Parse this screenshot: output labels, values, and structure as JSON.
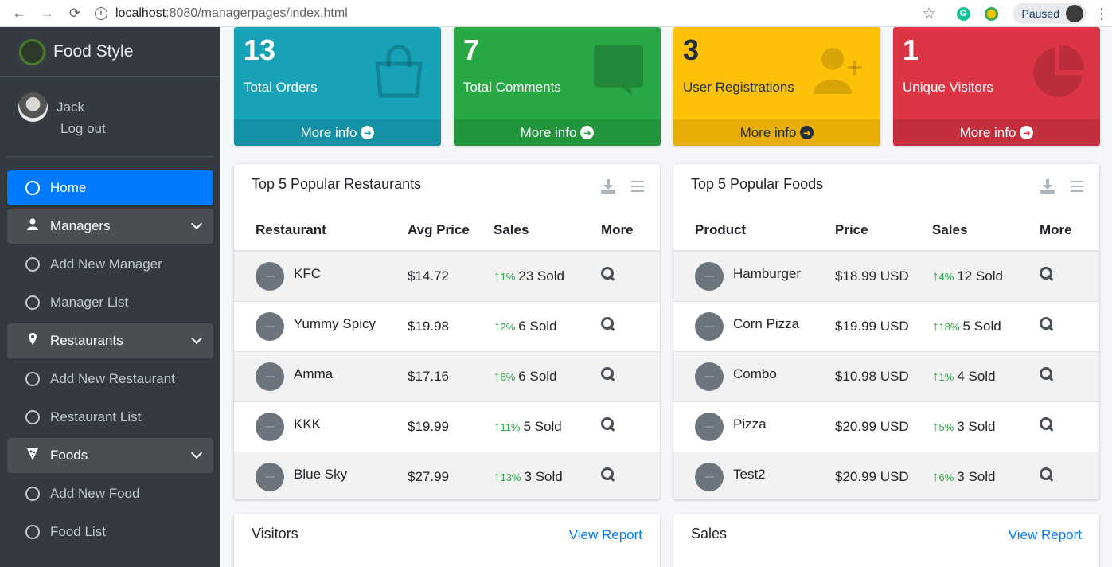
{
  "browser": {
    "back": "←",
    "forward": "→",
    "reload": "⟳",
    "info": "i",
    "url_host": "localhost",
    "url_path": ":8080/managerpages/index.html",
    "bookmark": "☆",
    "grammarly": "G",
    "paused": "Paused",
    "menu": "⋮"
  },
  "brand": {
    "name": "Food Style"
  },
  "user": {
    "name": "Jack",
    "logout": "Log out"
  },
  "menu": {
    "home": "Home",
    "managers": "Managers",
    "add_manager": "Add New Manager",
    "manager_list": "Manager List",
    "restaurants": "Restaurants",
    "add_restaurant": "Add New Restaurant",
    "restaurant_list": "Restaurant List",
    "foods": "Foods",
    "add_food": "Add New Food",
    "food_list": "Food List"
  },
  "stats": [
    {
      "value": "13",
      "label": "Total Orders",
      "more": "More info",
      "color": "#17a2b8"
    },
    {
      "value": "7",
      "label": "Total Comments",
      "more": "More info",
      "color": "#28a745"
    },
    {
      "value": "3",
      "label": "User Registrations",
      "more": "More info",
      "color": "#ffc107"
    },
    {
      "value": "1",
      "label": "Unique Visitors",
      "more": "More info",
      "color": "#dc3545"
    }
  ],
  "restaurants": {
    "title": "Top 5 Popular Restaurants",
    "headers": [
      "Restaurant",
      "Avg Price",
      "Sales",
      "More"
    ],
    "rows": [
      {
        "name": "KFC",
        "price": "$14.72",
        "pct": "1%",
        "sold": "23 Sold"
      },
      {
        "name": "Yummy Spicy",
        "price": "$19.98",
        "pct": "2%",
        "sold": "6 Sold"
      },
      {
        "name": "Amma",
        "price": "$17.16",
        "pct": "6%",
        "sold": "6 Sold"
      },
      {
        "name": "KKK",
        "price": "$19.99",
        "pct": "11%",
        "sold": "5 Sold"
      },
      {
        "name": "Blue Sky",
        "price": "$27.99",
        "pct": "13%",
        "sold": "3 Sold"
      }
    ]
  },
  "foods": {
    "title": "Top 5 Popular Foods",
    "headers": [
      "Product",
      "Price",
      "Sales",
      "More"
    ],
    "rows": [
      {
        "name": "Hamburger",
        "price": "$18.99 USD",
        "pct": "4%",
        "sold": "12 Sold"
      },
      {
        "name": "Corn Pizza",
        "price": "$19.99 USD",
        "pct": "18%",
        "sold": "5 Sold"
      },
      {
        "name": "Combo",
        "price": "$10.98 USD",
        "pct": "1%",
        "sold": "4 Sold"
      },
      {
        "name": "Pizza",
        "price": "$20.99 USD",
        "pct": "5%",
        "sold": "3 Sold"
      },
      {
        "name": "Test2",
        "price": "$20.99 USD",
        "pct": "6%",
        "sold": "3 Sold"
      }
    ]
  },
  "visitors": {
    "title": "Visitors",
    "link": "View Report"
  },
  "sales": {
    "title": "Sales",
    "link": "View Report"
  }
}
